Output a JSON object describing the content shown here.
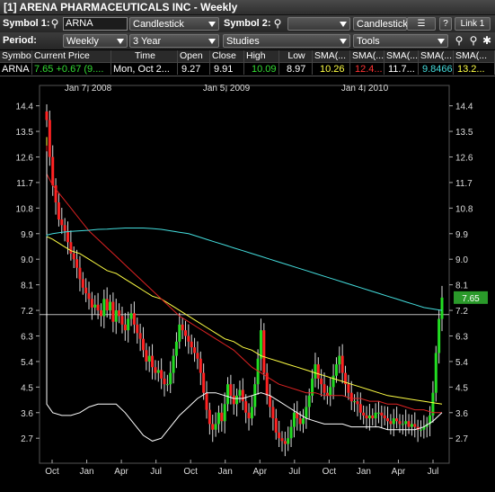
{
  "window": {
    "title": "[1] ARENA PHARMACEUTICALS INC - Weekly"
  },
  "toolbar": {
    "symbol1_label": "Symbol 1:",
    "symbol1_value": "ARNA",
    "chart_type": "Candlestick",
    "symbol2_label": "Symbol 2:",
    "symbol2_value": "",
    "chart_type2": "Candlestick",
    "help_label": "?",
    "link_label": "Link 1",
    "period_label": "Period:",
    "period_value": "Weekly",
    "range_value": "3 Year",
    "studies_label": "Studies",
    "tools_label": "Tools"
  },
  "quote": {
    "headers": [
      "Symbol",
      "Current Price",
      "Time",
      "Open",
      "Close",
      "High",
      "Low",
      "SMA(...",
      "SMA(...",
      "SMA(...",
      "SMA(...",
      "SMA(..."
    ],
    "symbol": "ARNA",
    "price": "7.65",
    "change": "+0.67 (9....",
    "time": "Mon, Oct 2...",
    "open": "9.27",
    "close": "9.91",
    "high": "10.09",
    "low": "8.97",
    "sma1": "10.26",
    "sma2": "12.4...",
    "sma3": "11.7...",
    "sma4": "9.8466",
    "sma5": "13.2...",
    "colors": {
      "price": "#33dd33",
      "change": "#33dd33",
      "high": "#33dd33",
      "sma1": "#ffff44",
      "sma2": "#ff3333",
      "sma3": "#ffffff",
      "sma4": "#44dddd",
      "sma5": "#ffff44"
    }
  },
  "chart_data": {
    "type": "candlestick",
    "top_dates": [
      "Jan 7, 2008",
      "Jan 5, 2009",
      "Jan 4, 2010"
    ],
    "x_ticks": [
      "Oct",
      "Jan",
      "Apr",
      "Jul",
      "Oct",
      "Jan",
      "Apr",
      "Jul",
      "Oct",
      "Jan",
      "Apr",
      "Jul"
    ],
    "y_ticks": [
      "14.4",
      "13.5",
      "12.6",
      "11.7",
      "10.8",
      "9.9",
      "9.0",
      "8.1",
      "7.2",
      "6.3",
      "5.4",
      "4.5",
      "3.6",
      "2.7"
    ],
    "ylim": [
      2.2,
      14.8
    ],
    "last_price_label": "7.65",
    "last_price": 7.65,
    "reference_line": 7.05,
    "closes": [
      13.9,
      12.6,
      11.6,
      11.0,
      10.4,
      10.2,
      10.0,
      9.6,
      9.2,
      9.0,
      8.7,
      8.3,
      8.0,
      7.8,
      7.6,
      7.3,
      7.4,
      7.2,
      7.0,
      7.6,
      7.2,
      7.5,
      6.8,
      7.2,
      7.0,
      6.7,
      6.5,
      6.9,
      7.1,
      6.7,
      6.4,
      6.2,
      5.8,
      5.4,
      5.6,
      5.2,
      5.0,
      5.1,
      4.8,
      4.6,
      4.6,
      5.0,
      5.6,
      6.1,
      6.7,
      6.5,
      6.3,
      6.1,
      5.9,
      5.7,
      5.5,
      5.0,
      4.3,
      3.7,
      3.2,
      3.0,
      3.2,
      3.6,
      3.3,
      3.9,
      4.6,
      4.2,
      3.9,
      4.2,
      4.4,
      4.0,
      3.6,
      3.4,
      3.8,
      4.6,
      5.5,
      6.5,
      5.0,
      4.2,
      3.8,
      3.4,
      2.9,
      2.7,
      2.6,
      2.5,
      2.7,
      3.1,
      3.6,
      3.4,
      3.2,
      3.4,
      3.8,
      4.2,
      4.8,
      5.3,
      4.8,
      4.6,
      4.3,
      4.2,
      4.5,
      4.9,
      5.3,
      5.6,
      5.0,
      4.6,
      4.3,
      4.0,
      4.0,
      3.9,
      3.6,
      3.5,
      3.4,
      3.5,
      3.4,
      3.6,
      3.6,
      3.5,
      3.4,
      3.3,
      3.2,
      3.4,
      3.3,
      3.2,
      3.2,
      3.3,
      3.1,
      3.2,
      3.1,
      3.0,
      3.0,
      3.1,
      3.2,
      3.5,
      4.3,
      5.7,
      6.9,
      7.65
    ],
    "series": [
      {
        "name": "SMA yellow",
        "color": "#ffff44",
        "values": [
          13.3,
          13.3,
          13.3,
          13.2,
          13.0,
          12.9,
          12.7,
          12.6,
          12.4,
          12.2,
          12.1,
          11.9,
          11.7,
          11.6,
          11.4,
          11.2,
          11.0,
          10.8,
          10.7,
          10.5,
          10.3,
          10.2,
          10.0,
          9.8,
          9.7,
          9.5,
          9.3,
          9.2,
          9.0,
          8.8,
          8.6,
          8.5,
          8.3,
          8.1,
          7.9,
          7.7,
          7.6,
          7.4,
          7.2,
          7.0,
          6.8,
          6.6,
          6.4,
          6.2,
          6.1,
          5.9,
          5.8,
          5.6,
          5.5,
          5.4,
          5.3,
          5.2,
          5.1,
          5.0,
          4.9,
          4.8,
          4.7,
          4.6,
          4.5,
          4.4,
          4.3,
          4.2,
          4.15,
          4.1,
          4.05,
          4.0,
          3.95,
          3.9
        ]
      },
      {
        "name": "SMA red",
        "color": "#dd2222",
        "values": [
          13.0,
          12.7,
          12.4,
          12.0,
          11.6,
          11.2,
          10.8,
          10.4,
          10.0,
          9.7,
          9.4,
          9.1,
          8.8,
          8.5,
          8.2,
          7.9,
          7.6,
          7.3,
          7.0,
          6.8,
          6.6,
          6.4,
          6.2,
          6.0,
          5.8,
          5.5,
          5.2,
          5.0,
          4.8,
          4.6,
          4.5,
          4.4,
          4.3,
          4.3,
          4.2,
          4.2,
          4.2,
          4.1,
          4.1,
          4.0,
          4.0,
          3.9,
          3.9,
          3.8,
          3.7,
          3.7,
          3.6,
          3.6
        ]
      },
      {
        "name": "SMA white",
        "color": "#ffffff",
        "values": [
          12.8,
          11.9,
          11.0,
          10.3,
          9.6,
          9.0,
          8.5,
          8.1,
          7.7,
          7.4,
          7.1,
          6.8,
          6.5,
          6.2,
          5.9,
          5.6,
          5.3,
          5.1,
          4.9,
          4.8,
          4.8,
          5.0,
          5.3,
          5.6,
          5.8,
          5.9,
          5.9,
          5.7,
          5.5,
          5.2,
          4.9,
          4.6,
          4.2,
          3.9,
          3.6,
          3.5,
          3.5,
          3.6,
          3.8,
          3.9,
          3.9,
          3.9,
          3.6,
          3.2,
          2.8,
          2.6,
          2.7,
          3.1,
          3.5,
          3.8,
          4.1,
          4.3,
          4.3,
          4.2,
          4.1,
          4.1,
          4.2,
          4.3,
          4.2,
          4.0,
          3.8,
          3.6,
          3.4,
          3.3,
          3.2,
          3.2,
          3.2,
          3.1,
          3.1,
          3.1,
          3.1,
          3.0,
          3.0,
          3.0,
          3.0,
          3.1,
          3.3,
          3.6
        ]
      },
      {
        "name": "SMA cyan",
        "color": "#44dddd",
        "values": [
          9.8,
          9.85,
          9.9,
          9.95,
          9.98,
          10.0,
          10.02,
          10.05,
          10.06,
          10.08,
          10.1,
          10.1,
          10.1,
          10.08,
          10.05,
          10.0,
          9.95,
          9.9,
          9.8,
          9.7,
          9.6,
          9.5,
          9.4,
          9.3,
          9.2,
          9.1,
          9.0,
          8.9,
          8.8,
          8.7,
          8.6,
          8.5,
          8.4,
          8.3,
          8.2,
          8.1,
          8.0,
          7.9,
          7.8,
          7.7,
          7.6,
          7.5,
          7.4,
          7.3,
          7.25,
          7.2
        ]
      }
    ]
  }
}
